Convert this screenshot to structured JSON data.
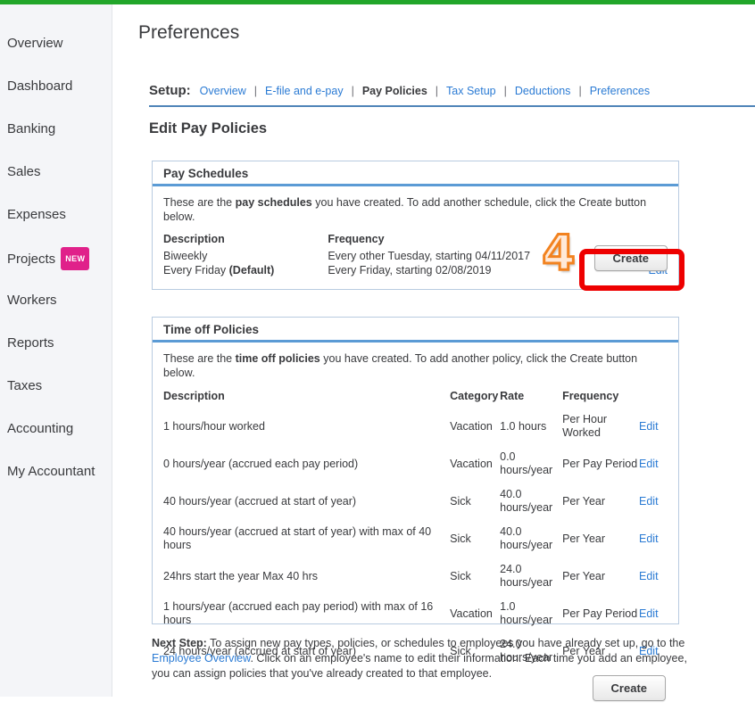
{
  "topbar": {
    "color": "#22a62a"
  },
  "sidebar": {
    "items": [
      {
        "label": "Overview",
        "badge": null
      },
      {
        "label": "Dashboard",
        "badge": null
      },
      {
        "label": "Banking",
        "badge": null
      },
      {
        "label": "Sales",
        "badge": null
      },
      {
        "label": "Expenses",
        "badge": null
      },
      {
        "label": "Projects",
        "badge": "NEW"
      },
      {
        "label": "Workers",
        "badge": null
      },
      {
        "label": "Reports",
        "badge": null
      },
      {
        "label": "Taxes",
        "badge": null
      },
      {
        "label": "Accounting",
        "badge": null
      },
      {
        "label": "My Accountant",
        "badge": null
      }
    ]
  },
  "header": {
    "title": "Preferences"
  },
  "setup": {
    "label": "Setup:",
    "links": [
      {
        "text": "Overview",
        "active": false
      },
      {
        "text": "E-file and e-pay",
        "active": false
      },
      {
        "text": "Pay Policies",
        "active": true
      },
      {
        "text": "Tax Setup",
        "active": false
      },
      {
        "text": "Deductions",
        "active": false
      },
      {
        "text": "Preferences",
        "active": false
      }
    ],
    "separator": "|"
  },
  "section_heading": "Edit Pay Policies",
  "pay_schedules": {
    "panel_title": "Pay Schedules",
    "intro_pre": "These are the ",
    "intro_bold": "pay schedules",
    "intro_post": " you have created. To add another schedule, click the Create button below.",
    "columns": [
      "Description",
      "Frequency",
      ""
    ],
    "rows": [
      {
        "description": "Biweekly",
        "description_bold": "",
        "frequency": "Every other Tuesday, starting 04/11/2017",
        "edit": "Edit"
      },
      {
        "description": "Every Friday ",
        "description_bold": "(Default)",
        "frequency": "Every Friday, starting 02/08/2019",
        "edit": "Edit"
      }
    ],
    "create_label": "Create"
  },
  "time_off_policies": {
    "panel_title": "Time off Policies",
    "intro_pre": "These are the ",
    "intro_bold": "time off policies",
    "intro_post": " you have created. To add another policy, click the Create button below.",
    "columns": [
      "Description",
      "Category",
      "Rate",
      "Frequency",
      ""
    ],
    "rows": [
      {
        "description": "1 hours/hour worked",
        "category": "Vacation",
        "rate": "1.0 hours",
        "frequency": "Per Hour Worked",
        "edit": "Edit"
      },
      {
        "description": "0 hours/year (accrued each pay period)",
        "category": "Vacation",
        "rate": "0.0 hours/year",
        "frequency": "Per Pay Period",
        "edit": "Edit"
      },
      {
        "description": "40 hours/year (accrued at start of year)",
        "category": "Sick",
        "rate": "40.0 hours/year",
        "frequency": "Per Year",
        "edit": "Edit"
      },
      {
        "description": "40 hours/year (accrued at start of year) with max of 40 hours",
        "category": "Sick",
        "rate": "40.0 hours/year",
        "frequency": "Per Year",
        "edit": "Edit"
      },
      {
        "description": "24hrs start the year Max 40 hrs",
        "category": "Sick",
        "rate": "24.0 hours/year",
        "frequency": "Per Year",
        "edit": "Edit"
      },
      {
        "description": "1 hours/year (accrued each pay period) with max of 16 hours",
        "category": "Vacation",
        "rate": "1.0 hours/year",
        "frequency": "Per Pay Period",
        "edit": "Edit"
      },
      {
        "description": "24 hours/year (accrued at start of year)",
        "category": "Sick",
        "rate": "24.0 hours/year",
        "frequency": "Per Year",
        "edit": "Edit"
      }
    ],
    "create_label": "Create"
  },
  "next_step": {
    "label": "Next Step:",
    "text_before_link": " To assign new pay types, policies, or schedules to employees you have already set up, go to the ",
    "link": "Employee Overview",
    "text_after_link": ". Click on an employee's name to edit their information. Each time you add an employee, you can assign policies that you've already created to that employee."
  },
  "annotation": {
    "number": "4",
    "number_color": "#f2821f",
    "highlight_color": "#ee0000"
  }
}
